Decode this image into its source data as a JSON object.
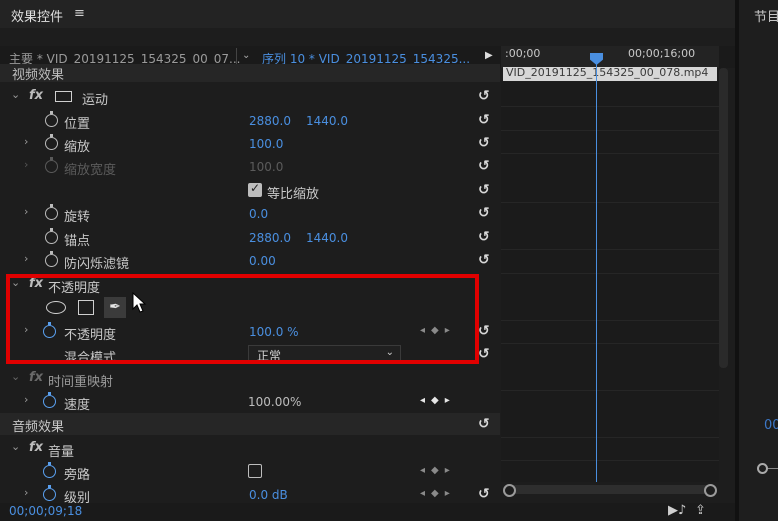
{
  "panel": {
    "title": "效果控件",
    "menu_icon": "≡",
    "right_title": "节目",
    "right_value": "00"
  },
  "header": {
    "master": "主要 * VID_20191125_154325_00_07...",
    "sequence": "序列 10 * VID_20191125_154325..."
  },
  "sections": {
    "video": "视频效果",
    "audio": "音频效果"
  },
  "motion": {
    "label": "运动",
    "position_label": "位置",
    "position_x": "2880.0",
    "position_y": "1440.0",
    "scale_label": "缩放",
    "scale_value": "100.0",
    "scale_width_label": "缩放宽度",
    "scale_width_value": "100.0",
    "uniform_scale_label": "等比缩放",
    "rotation_label": "旋转",
    "rotation_value": "0.0",
    "anchor_label": "锚点",
    "anchor_x": "2880.0",
    "anchor_y": "1440.0",
    "antiflicker_label": "防闪烁滤镜",
    "antiflicker_value": "0.00"
  },
  "opacity": {
    "label": "不透明度",
    "opacity_label": "不透明度",
    "opacity_value": "100.0 %",
    "blend_label": "混合模式",
    "blend_value": "正常"
  },
  "time_remap": {
    "label": "时间重映射",
    "speed_label": "速度",
    "speed_value": "100.00%"
  },
  "volume": {
    "label": "音量",
    "bypass_label": "旁路",
    "level_label": "级别",
    "level_value": "0.0 dB"
  },
  "timeline": {
    "t0": ":00;00",
    "t1": "00;00;16;00",
    "clip_name": "VID_20191125_154325_00_078.mp4"
  },
  "footer": {
    "timecode": "00;00;09;18"
  },
  "glyphs": {
    "fx": "fx",
    "chev_down": "⌄",
    "chev_right": "›",
    "reset": "↺",
    "kf_nav": "◂◆▸",
    "dropdown_arrow": "⌄",
    "pen": "✒",
    "play": "▶"
  },
  "colors": {
    "accent_blue": "#4a8fe0",
    "highlight_red": "#e00000"
  }
}
